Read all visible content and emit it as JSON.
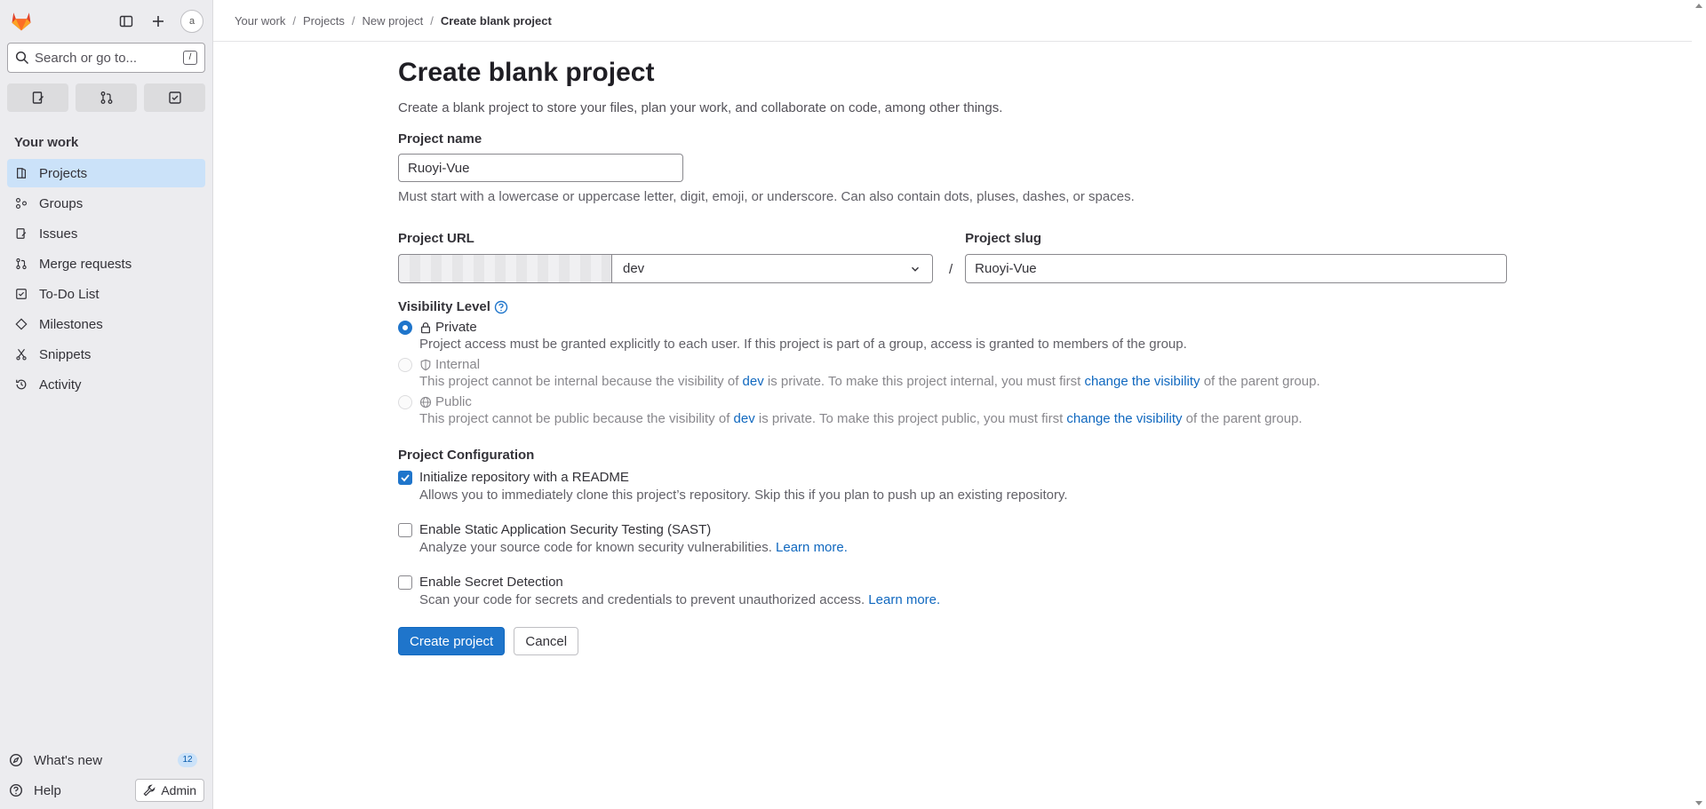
{
  "sidebar": {
    "search_placeholder": "Search or go to...",
    "search_shortcut": "/",
    "avatar_alt": "a",
    "section_title": "Your work",
    "items": [
      {
        "label": "Projects",
        "icon": "project-icon",
        "active": true
      },
      {
        "label": "Groups",
        "icon": "group-icon",
        "active": false
      },
      {
        "label": "Issues",
        "icon": "issues-icon",
        "active": false
      },
      {
        "label": "Merge requests",
        "icon": "merge-request-icon",
        "active": false
      },
      {
        "label": "To-Do List",
        "icon": "todo-icon",
        "active": false
      },
      {
        "label": "Milestones",
        "icon": "milestone-icon",
        "active": false
      },
      {
        "label": "Snippets",
        "icon": "snippet-icon",
        "active": false
      },
      {
        "label": "Activity",
        "icon": "history-icon",
        "active": false
      }
    ],
    "whats_new": {
      "label": "What's new",
      "count": "12"
    },
    "help": {
      "label": "Help"
    },
    "admin": {
      "label": "Admin"
    }
  },
  "breadcrumb": [
    "Your work",
    "Projects",
    "New project",
    "Create blank project"
  ],
  "page": {
    "title": "Create blank project",
    "lead": "Create a blank project to store your files, plan your work, and collaborate on code, among other things.",
    "project_name": {
      "label": "Project name",
      "value": "Ruoyi-Vue",
      "help": "Must start with a lowercase or uppercase letter, digit, emoji, or underscore. Can also contain dots, pluses, dashes, or spaces."
    },
    "project_url": {
      "label": "Project URL",
      "namespace": "dev",
      "separator": "/"
    },
    "project_slug": {
      "label": "Project slug",
      "value": "Ruoyi-Vue"
    },
    "visibility": {
      "label": "Visibility Level",
      "options": [
        {
          "label": "Private",
          "checked": true,
          "disabled": false,
          "desc": "Project access must be granted explicitly to each user. If this project is part of a group, access is granted to members of the group."
        },
        {
          "label": "Internal",
          "checked": false,
          "disabled": true,
          "desc_a": "This project cannot be internal because the visibility of",
          "desc_link1": "dev",
          "desc_b": "is private. To make this project internal, you must first",
          "desc_link2": "change the visibility",
          "desc_c": "of the parent group."
        },
        {
          "label": "Public",
          "checked": false,
          "disabled": true,
          "desc_a": "This project cannot be public because the visibility of",
          "desc_link1": "dev",
          "desc_b": "is private. To make this project public, you must first",
          "desc_link2": "change the visibility",
          "desc_c": "of the parent group."
        }
      ]
    },
    "config": {
      "label": "Project Configuration",
      "options": [
        {
          "label": "Initialize repository with a README",
          "checked": true,
          "desc": "Allows you to immediately clone this project’s repository. Skip this if you plan to push up an existing repository."
        },
        {
          "label": "Enable Static Application Security Testing (SAST)",
          "checked": false,
          "desc": "Analyze your source code for known security vulnerabilities.",
          "link": "Learn more."
        },
        {
          "label": "Enable Secret Detection",
          "checked": false,
          "desc": "Scan your code for secrets and credentials to prevent unauthorized access.",
          "link": "Learn more."
        }
      ]
    },
    "buttons": {
      "create": "Create project",
      "cancel": "Cancel"
    }
  },
  "colors": {
    "accent": "#1f75cb",
    "sidebar_bg": "#ececef",
    "active_nav": "#cbe2f9",
    "link": "#1068bf"
  }
}
